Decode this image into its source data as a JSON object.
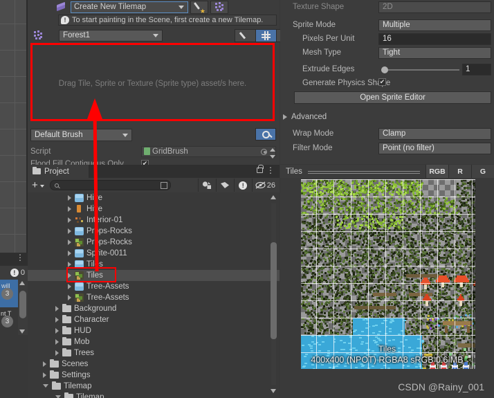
{
  "palette": {
    "tilemap_dropdown": "Create New Tilemap",
    "info_message": "To start painting in the Scene, first create a new Tilemap.",
    "palette_dropdown": "Forest1",
    "drop_hint": "Drag Tile, Sprite or Texture (Sprite type) asset/s here.",
    "brush_dropdown": "Default Brush",
    "script_label": "Script",
    "script_value": "GridBrush",
    "flood_label": "Flood Fill Contiguous Only",
    "tools": [
      {
        "name": "edit-brush-tool",
        "icon": "pencil-icon",
        "active": false
      },
      {
        "name": "grid-tool",
        "icon": "grid-icon",
        "active": true
      },
      {
        "name": "gizmo-tool",
        "icon": "globe-icon",
        "active": false
      }
    ]
  },
  "inspector": {
    "rows": [
      {
        "label": "Texture Shape",
        "value": "2D",
        "kind": "readonly"
      },
      {
        "label": "Sprite Mode",
        "value": "Multiple",
        "kind": "dropdown"
      },
      {
        "label": "Pixels Per Unit",
        "value": "16",
        "kind": "number"
      },
      {
        "label": "Mesh Type",
        "value": "Tight",
        "kind": "dropdown"
      },
      {
        "label": "Extrude Edges",
        "value": "1",
        "kind": "slider"
      },
      {
        "label": "Generate Physics Shape",
        "value": "",
        "kind": "checkbox"
      }
    ],
    "open_sprite_editor": "Open Sprite Editor",
    "advanced": "Advanced",
    "wrap_mode_label": "Wrap Mode",
    "wrap_mode_value": "Clamp",
    "filter_mode_label": "Filter Mode",
    "filter_mode_value": "Point (no filter)"
  },
  "project": {
    "tab_label": "Project",
    "search_placeholder": "",
    "hidden_count": "26",
    "tree": [
      {
        "label": "Hive",
        "icon": "prefab-icon",
        "indent": 3,
        "selected": false
      },
      {
        "label": "Hive",
        "icon": "orange-icon",
        "indent": 3,
        "selected": false
      },
      {
        "label": "Interior-01",
        "icon": "dots-icon",
        "indent": 3,
        "selected": false
      },
      {
        "label": "Props-Rocks",
        "icon": "prefab-icon",
        "indent": 3,
        "selected": false
      },
      {
        "label": "Props-Rocks",
        "icon": "texture-icon",
        "indent": 3,
        "selected": false
      },
      {
        "label": "Sprite-0011",
        "icon": "prefab-icon",
        "indent": 3,
        "selected": false
      },
      {
        "label": "Tiles",
        "icon": "prefab-icon",
        "indent": 3,
        "selected": false
      },
      {
        "label": "Tiles",
        "icon": "texture-icon",
        "indent": 3,
        "selected": true
      },
      {
        "label": "Tree-Assets",
        "icon": "prefab-icon",
        "indent": 3,
        "selected": false
      },
      {
        "label": "Tree-Assets",
        "icon": "texture-icon",
        "indent": 3,
        "selected": false
      },
      {
        "label": "Background",
        "icon": "folder-icon",
        "indent": 2,
        "selected": false
      },
      {
        "label": "Character",
        "icon": "folder-icon",
        "indent": 2,
        "selected": false
      },
      {
        "label": "HUD",
        "icon": "folder-icon",
        "indent": 2,
        "selected": false
      },
      {
        "label": "Mob",
        "icon": "folder-icon",
        "indent": 2,
        "selected": false
      },
      {
        "label": "Trees",
        "icon": "folder-icon",
        "indent": 2,
        "selected": false
      },
      {
        "label": "Scenes",
        "icon": "folder-icon",
        "indent": 1,
        "selected": false
      },
      {
        "label": "Settings",
        "icon": "folder-icon",
        "indent": 1,
        "selected": false
      },
      {
        "label": "Tilemap",
        "icon": "folder-open-icon",
        "indent": 1,
        "selected": false,
        "expanded": true
      },
      {
        "label": "Tilemap",
        "icon": "folder-open-icon",
        "indent": 2,
        "selected": false,
        "expanded": true
      }
    ]
  },
  "tiles_preview": {
    "title": "Tiles",
    "channels": [
      "RGB",
      "R",
      "G"
    ],
    "overlay_name": "Tiles",
    "overlay_info": "400x400 (NPOT)  RGBA8 sRGB  0.6 MB"
  },
  "console_sliver": {
    "error_count": "0",
    "rows": [
      {
        "badge": "3",
        "text": "will",
        "selected": true
      },
      {
        "badge": "3",
        "text": "nt  T",
        "selected": false
      }
    ]
  },
  "watermark": "CSDN @Rainy_001",
  "colors": {
    "accent_blue": "#4a73a8",
    "annotation_red": "#ff0000",
    "panel_bg": "#3c3c3c",
    "selection": "#4d4d4d"
  }
}
